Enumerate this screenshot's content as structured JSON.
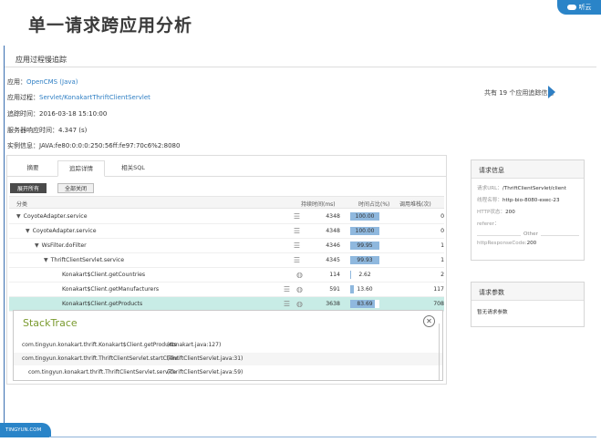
{
  "header": {
    "title": "单一请求跨应用分析",
    "brand": "听云"
  },
  "subtitle": "应用过程慢追踪",
  "info": {
    "app_label": "应用：",
    "app_value": "OpenCMS (Java)",
    "process_label": "应用过程：",
    "process_value": "Servlet/KonakartThriftClientServlet",
    "time_label": "追踪时间：",
    "time_value": "2016-03-18 15:10:00",
    "resp_label": "服务器响应时间：",
    "resp_value": "4.347 (s)",
    "instance_label": "实例信息：",
    "instance_value": "JAVA:fe80:0:0:0:250:56ff:fe97:70c6%2:8080"
  },
  "trace_count": "共有 19 个应用追踪信息",
  "tabs": [
    "摘要",
    "追踪详情",
    "相关SQL"
  ],
  "buttons": {
    "expand_all": "展开所有",
    "collapse_all": "全部关闭"
  },
  "table": {
    "headers": {
      "name": "分类",
      "duration": "持续时间(ms)",
      "percent": "时间占比(%)",
      "count": "调用堆栈(次)"
    },
    "rows": [
      {
        "name": "CoyoteAdapter.service",
        "caret": "▼",
        "indent": 0,
        "icons": [
          "list"
        ],
        "duration": "4348",
        "percent": "100.00",
        "pct": 100,
        "count": "0"
      },
      {
        "name": "CoyoteAdapter.service",
        "caret": "▼",
        "indent": 1,
        "icons": [
          "list"
        ],
        "duration": "4348",
        "percent": "100.00",
        "pct": 100,
        "count": "0"
      },
      {
        "name": "WsFilter.doFilter",
        "caret": "▼",
        "indent": 2,
        "icons": [
          "list"
        ],
        "duration": "4346",
        "percent": "99.95",
        "pct": 99.95,
        "count": "1"
      },
      {
        "name": "ThriftClientServlet.service",
        "caret": "▼",
        "indent": 3,
        "icons": [
          "list"
        ],
        "duration": "4345",
        "percent": "99.93",
        "pct": 99.93,
        "count": "1"
      },
      {
        "name": "Konakart$Client.getCountries",
        "caret": "",
        "indent": 4,
        "icons": [
          "globe"
        ],
        "duration": "114",
        "percent": "2.62",
        "pct": 2.62,
        "count": "2"
      },
      {
        "name": "Konakart$Client.getManufacturers",
        "caret": "",
        "indent": 4,
        "icons": [
          "list",
          "globe"
        ],
        "duration": "591",
        "percent": "13.60",
        "pct": 13.6,
        "count": "117"
      },
      {
        "name": "Konakart$Client.getProducts",
        "caret": "",
        "indent": 4,
        "icons": [
          "list",
          "globe"
        ],
        "duration": "3638",
        "percent": "83.69",
        "pct": 83.69,
        "count": "708",
        "highlight": true
      }
    ]
  },
  "stacktrace": {
    "title": "StackTrace",
    "lines": [
      {
        "method": "com.tingyun.konakart.thrift.Konakart$Client.getProducts",
        "file": "(Konakart.java:127)"
      },
      {
        "method": "com.tingyun.konakart.thrift.ThriftClientServlet.startClient",
        "file": "(ThriftClientServlet.java:31)"
      },
      {
        "method": "com.tingyun.konakart.thrift.ThriftClientServlet.service",
        "file": "(ThriftClientServlet.java:59)"
      }
    ]
  },
  "request_info": {
    "title": "请求信息",
    "url_label": "请求URL：",
    "url_value": "/ThriftClientServlet/client",
    "thread_label": "线程名称：",
    "thread_value": "http-bio-8080-exec-23",
    "status_label": "HTTP状态：",
    "status_value": "200",
    "referer_label": "referer：",
    "other_label": "Other",
    "resp_code_label": "httpResponseCode:",
    "resp_code_value": "200"
  },
  "request_params": {
    "title": "请求参数",
    "empty_text": "暂无请求参数"
  },
  "footer": {
    "site": "TINGYUN.COM"
  },
  "colors": {
    "accent": "#2a84c8",
    "link": "#2f7fc4",
    "highlight_row": "#c8ece6",
    "bar": "#8fb8de",
    "stack_title": "#7a9a2e"
  }
}
